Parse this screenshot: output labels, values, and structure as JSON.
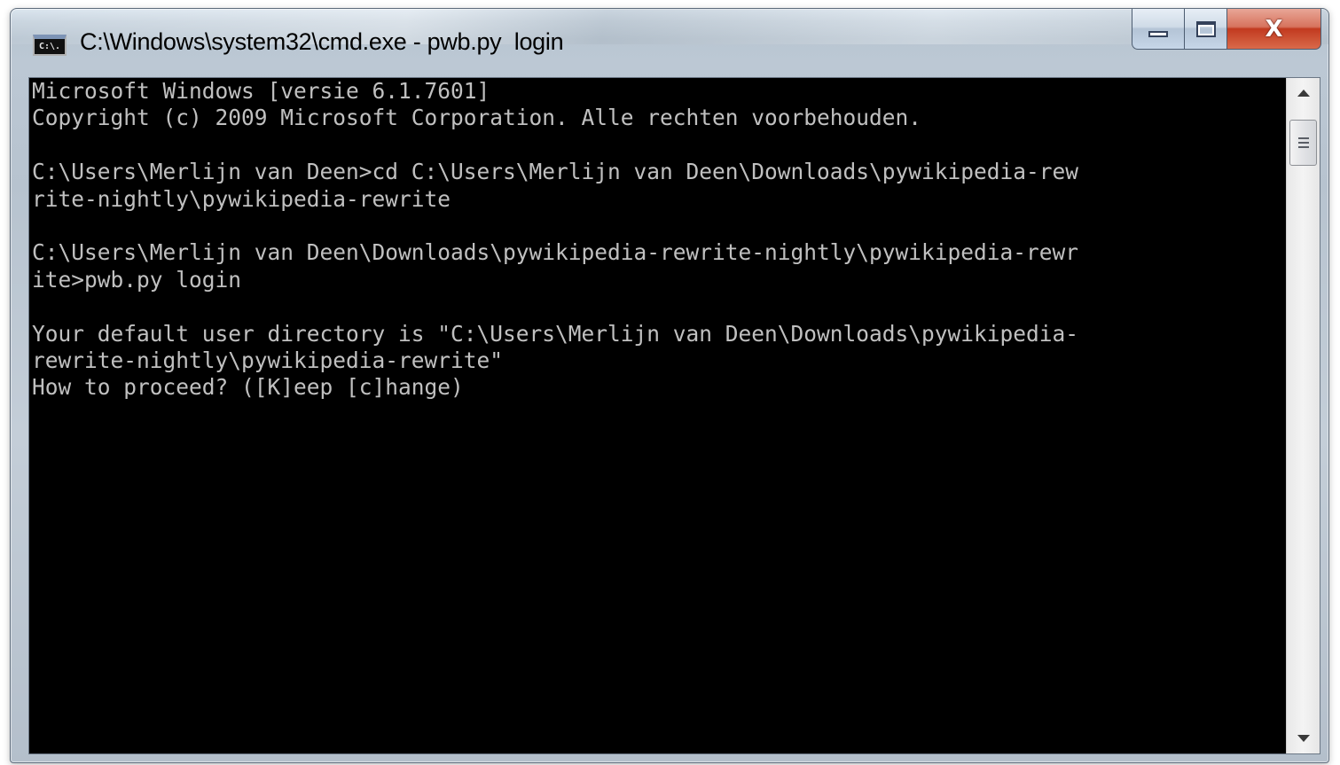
{
  "window": {
    "title": "C:\\Windows\\system32\\cmd.exe - pwb.py  login",
    "icon_label": "C:\\."
  },
  "caption_buttons": {
    "minimize_icon": "minimize-icon",
    "maximize_icon": "maximize-icon",
    "close_icon": "close-icon",
    "close_glyph": "X"
  },
  "console": {
    "lines": [
      "Microsoft Windows [versie 6.1.7601]",
      "Copyright (c) 2009 Microsoft Corporation. Alle rechten voorbehouden.",
      "",
      "C:\\Users\\Merlijn van Deen>cd C:\\Users\\Merlijn van Deen\\Downloads\\pywikipedia-rew",
      "rite-nightly\\pywikipedia-rewrite",
      "",
      "C:\\Users\\Merlijn van Deen\\Downloads\\pywikipedia-rewrite-nightly\\pywikipedia-rewr",
      "ite>pwb.py login",
      "",
      "Your default user directory is \"C:\\Users\\Merlijn van Deen\\Downloads\\pywikipedia-",
      "rewrite-nightly\\pywikipedia-rewrite\"",
      "How to proceed? ([K]eep [c]hange)"
    ]
  },
  "colors": {
    "console_bg": "#000000",
    "console_fg": "#c0c0c0",
    "close_button": "#c23a1f"
  }
}
